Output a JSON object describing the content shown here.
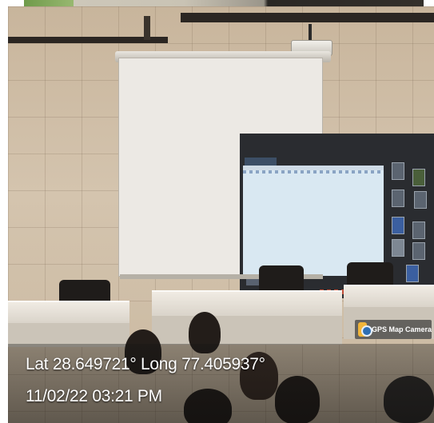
{
  "overlay": {
    "location": "Lat 28.649721° Long 77.405937°",
    "datetime": "11/02/22 03:21 PM",
    "app_badge": "GPS Map Camera",
    "app_icon": "map-camera-icon"
  },
  "colors": {
    "overlay_text": "#ffffff",
    "wall": "#cdbca4",
    "badge_accent": "#f1b53a"
  }
}
